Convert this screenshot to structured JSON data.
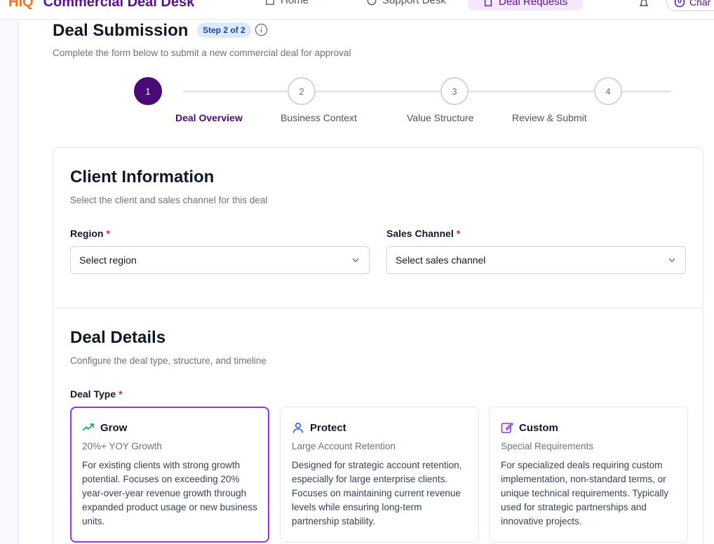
{
  "header": {
    "brand_logo": "HIQ",
    "brand_title": "Commercial Deal Desk",
    "nav": [
      {
        "label": "Home",
        "icon": "home-icon"
      },
      {
        "label": "Support Desk",
        "icon": "help-circle-icon"
      },
      {
        "label": "Deal Requests",
        "icon": "document-icon"
      }
    ],
    "user_label": "Char"
  },
  "page": {
    "title": "Deal Submission",
    "step_badge": "Step 2 of 2",
    "subtitle": "Complete the form below to submit a new commercial deal for approval"
  },
  "stepper": {
    "steps": [
      {
        "number": "1",
        "label": "Deal Overview",
        "active": true
      },
      {
        "number": "2",
        "label": "Business Context",
        "active": false
      },
      {
        "number": "3",
        "label": "Value Structure",
        "active": false
      },
      {
        "number": "4",
        "label": "Review & Submit",
        "active": false
      }
    ]
  },
  "client_info": {
    "title": "Client Information",
    "subtitle": "Select the client and sales channel for this deal",
    "region_label": "Region",
    "region_value": "Select region",
    "channel_label": "Sales Channel",
    "channel_value": "Select sales channel",
    "required_marker": "*"
  },
  "deal_details": {
    "title": "Deal Details",
    "subtitle": "Configure the deal type, structure, and timeline",
    "deal_type_label": "Deal Type",
    "required_marker": "*",
    "options": [
      {
        "name": "Grow",
        "tag": "20%+ YOY Growth",
        "description": "For existing clients with strong growth potential. Focuses on exceeding 20% year-over-year revenue growth through expanded product usage or new business units.",
        "icon": "trending-up-icon",
        "selected": true
      },
      {
        "name": "Protect",
        "tag": "Large Account Retention",
        "description": "Designed for strategic account retention, especially for large enterprise clients. Focuses on maintaining current revenue levels while ensuring long-term partnership stability.",
        "icon": "user-icon",
        "selected": false
      },
      {
        "name": "Custom",
        "tag": "Special Requirements",
        "description": "For specialized deals requiring custom implementation, non-standard terms, or unique technical requirements. Typically used for strategic partnerships and innovative projects.",
        "icon": "edit-icon",
        "selected": false
      }
    ]
  },
  "colors": {
    "primary": "#4a0a77",
    "selected_border": "#9333ea",
    "grow_icon": "#16a34a",
    "protect_icon": "#2563eb",
    "custom_icon": "#9333ea",
    "required": "#e11d48"
  }
}
